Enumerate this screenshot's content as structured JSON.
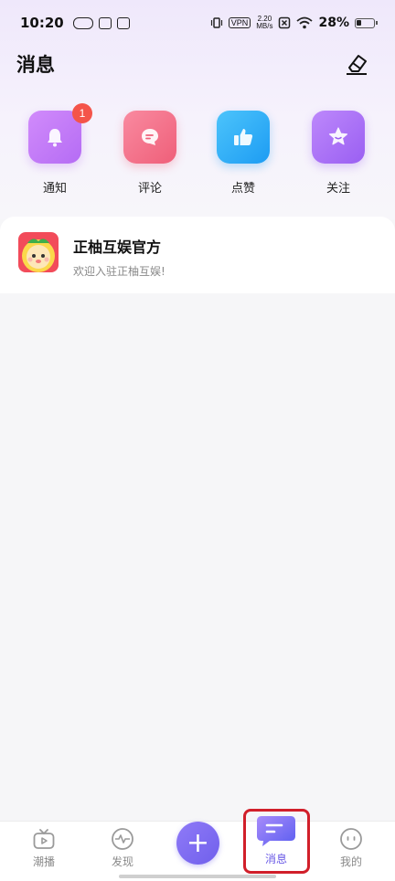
{
  "status_bar": {
    "time": "10:20",
    "vpn": "VPN",
    "net_speed_top": "2.20",
    "net_speed_bottom": "MB/s",
    "battery": "28%"
  },
  "header": {
    "title": "消息"
  },
  "categories": [
    {
      "label": "通知",
      "icon": "bell-icon",
      "badge": "1",
      "color": "#c27af8"
    },
    {
      "label": "评论",
      "icon": "comment-icon",
      "color": "#f46a82"
    },
    {
      "label": "点赞",
      "icon": "thumbs-up-icon",
      "color": "#2eb0f7"
    },
    {
      "label": "关注",
      "icon": "star-icon",
      "color": "#a36cf5"
    }
  ],
  "messages": [
    {
      "name": "正柚互娱官方",
      "preview": "欢迎入驻正柚互娱!"
    }
  ],
  "bottom_nav": {
    "items": [
      {
        "label": "潮播",
        "icon": "tv-icon"
      },
      {
        "label": "发现",
        "icon": "pulse-icon"
      },
      {
        "label": "+",
        "icon": "plus-icon"
      },
      {
        "label": "消息",
        "icon": "message-icon"
      },
      {
        "label": "我的",
        "icon": "face-icon"
      }
    ],
    "active": "消息"
  },
  "colors": {
    "accent": "#7060ec",
    "badge": "#f4544a",
    "highlight": "#d11f2a"
  }
}
